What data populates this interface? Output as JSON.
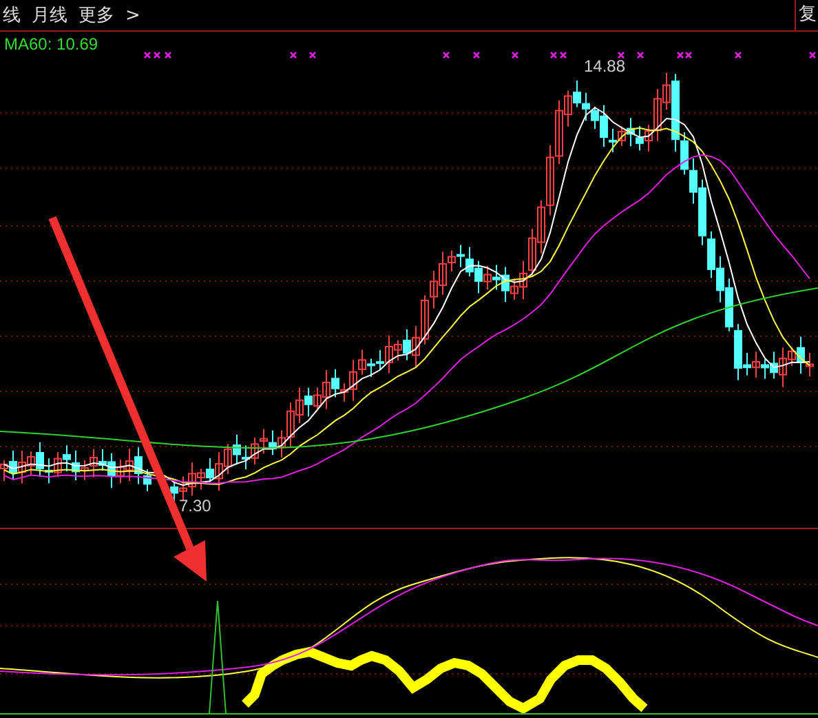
{
  "tabs": [
    {
      "label": "线",
      "selected": false
    },
    {
      "label": "月线",
      "selected": false
    },
    {
      "label": "更多",
      "selected": false
    }
  ],
  "more_arrow": ">",
  "right_tab": "复",
  "ma60_label": "MA60: 10.69",
  "high_label": "14.88",
  "low_label": "7.30"
}
